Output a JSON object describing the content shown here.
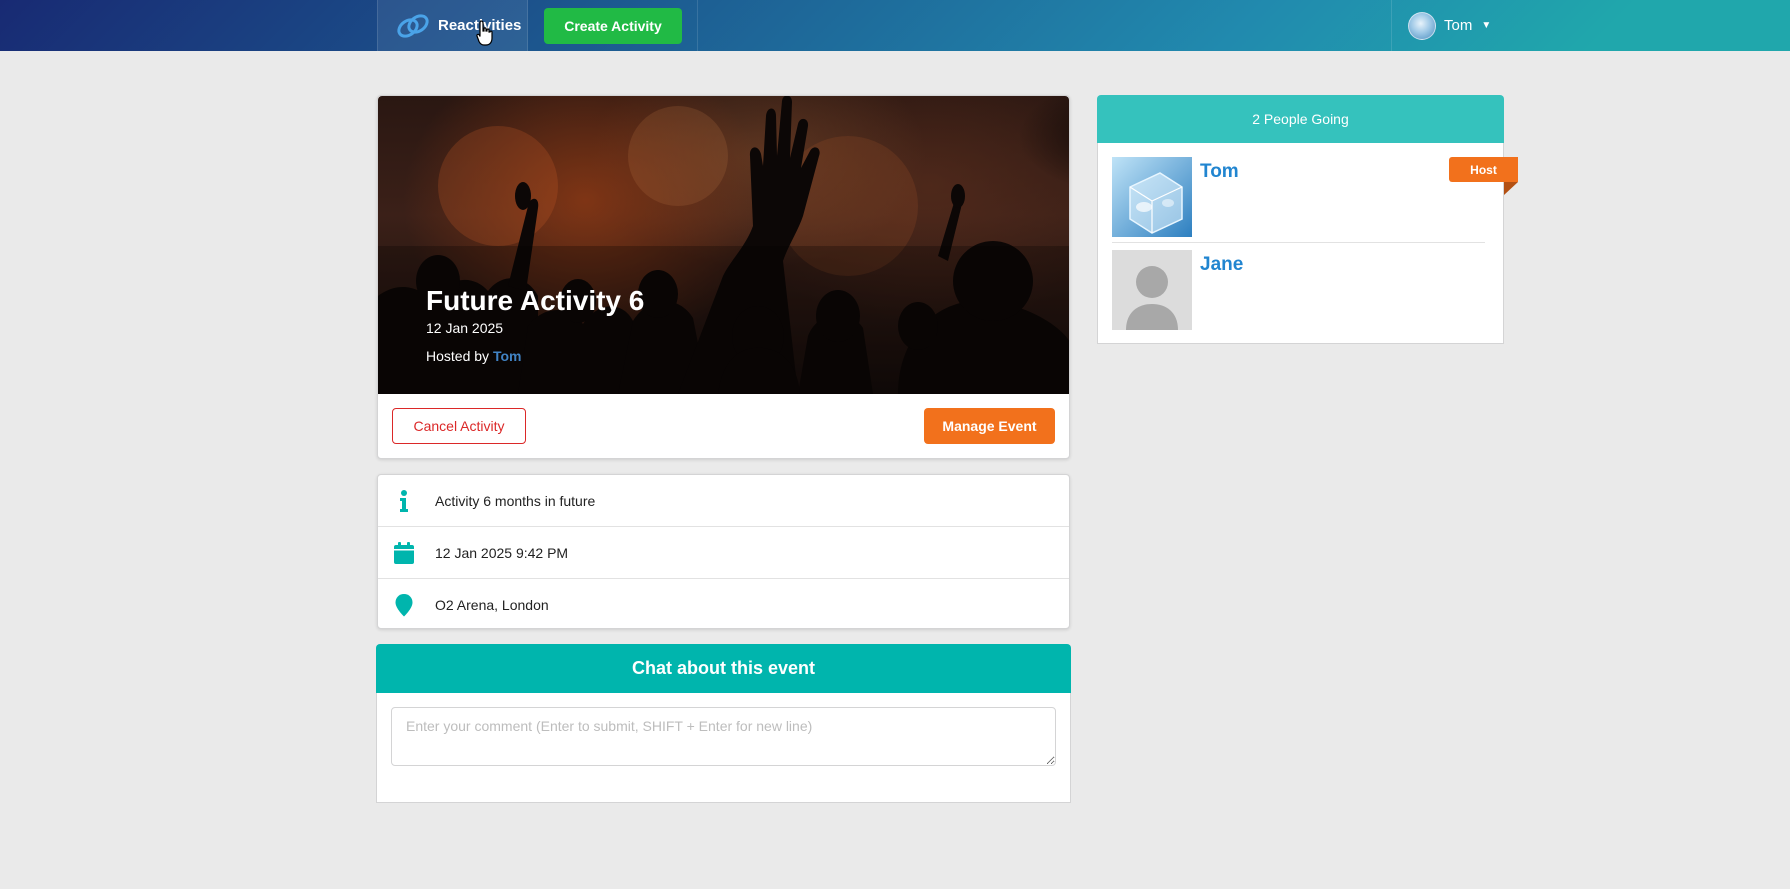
{
  "navbar": {
    "brand_label": "Reactivities",
    "create_button_label": "Create Activity",
    "user_name": "Tom"
  },
  "activity": {
    "title": "Future Activity 6",
    "date": "12 Jan 2025",
    "hosted_by_prefix": "Hosted by",
    "host_name": "Tom",
    "cancel_button_label": "Cancel Activity",
    "manage_button_label": "Manage Event"
  },
  "details": {
    "description": "Activity 6 months in future",
    "datetime": "12 Jan 2025 9:42 PM",
    "venue": "O2 Arena, London"
  },
  "chat": {
    "title": "Chat about this event",
    "placeholder": "Enter your comment (Enter to submit, SHIFT + Enter for new line)"
  },
  "attendees": {
    "heading": "2 People Going",
    "host_badge": "Host",
    "list": [
      {
        "name": "Tom",
        "avatar": "ice-cube-photo",
        "is_host": true
      },
      {
        "name": "Jane",
        "avatar": "default-user-silhouette",
        "is_host": false
      }
    ]
  },
  "colors": {
    "teal": "#00b5ad",
    "orange": "#f2711c",
    "green": "#21ba45",
    "red": "#db2828",
    "link_blue": "#2185d0"
  }
}
